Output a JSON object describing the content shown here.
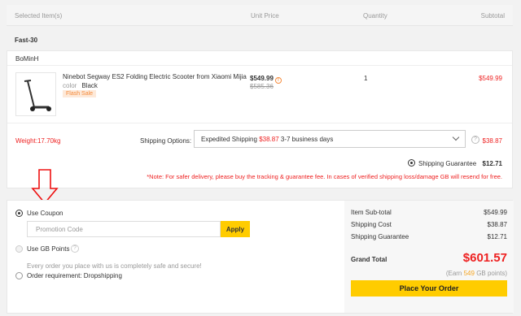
{
  "header": {
    "col_items": "Selected Item(s)",
    "col_price": "Unit Price",
    "col_qty": "Quantity",
    "col_subtotal": "Subtotal"
  },
  "warehouse": "Fast-30",
  "seller": "BoMinH",
  "product": {
    "name": "Ninebot Segway ES2 Folding Electric Scooter from Xiaomi Mijia",
    "color_label": "color",
    "color_value": "Black",
    "badge": "Flash Sale",
    "unit_price": "$549.99",
    "original_price": "$585.36",
    "quantity": "1",
    "subtotal": "$549.99"
  },
  "shipping": {
    "weight": "Weight:17.70kg",
    "options_label": "Shipping Options:",
    "method": "Expedited Shipping",
    "method_price": "$38.87",
    "method_time": "3-7 business days",
    "cost": "$38.87",
    "guarantee_label": "Shipping Guarantee",
    "guarantee_price": "$12.71",
    "note": "*Note: For safer delivery, please buy the tracking & guarantee fee. In cases of verified shipping loss/damage GB will resend for free."
  },
  "payment_options": {
    "coupon_label": "Use Coupon",
    "promo_placeholder": "Promotion Code",
    "apply_label": "Apply",
    "gb_points_label": "Use GB Points",
    "safe_text": "Every order you place with us is completely safe and secure!",
    "dropship_label": "Order requirement: Dropshipping"
  },
  "summary": {
    "subtotal_label": "Item Sub-total",
    "subtotal_value": "$549.99",
    "shipping_label": "Shipping Cost",
    "shipping_value": "$38.87",
    "guarantee_label": "Shipping Guarantee",
    "guarantee_value": "$12.71",
    "grand_label": "Grand Total",
    "grand_value": "$601.57",
    "earn_prefix": "(Earn",
    "earn_points": "549",
    "earn_suffix": "GB points)",
    "place_order_label": "Place Your Order"
  },
  "colors": {
    "accent_yellow": "#ffcc00",
    "price_red": "#e22222",
    "flash_orange": "#f58b3c"
  }
}
